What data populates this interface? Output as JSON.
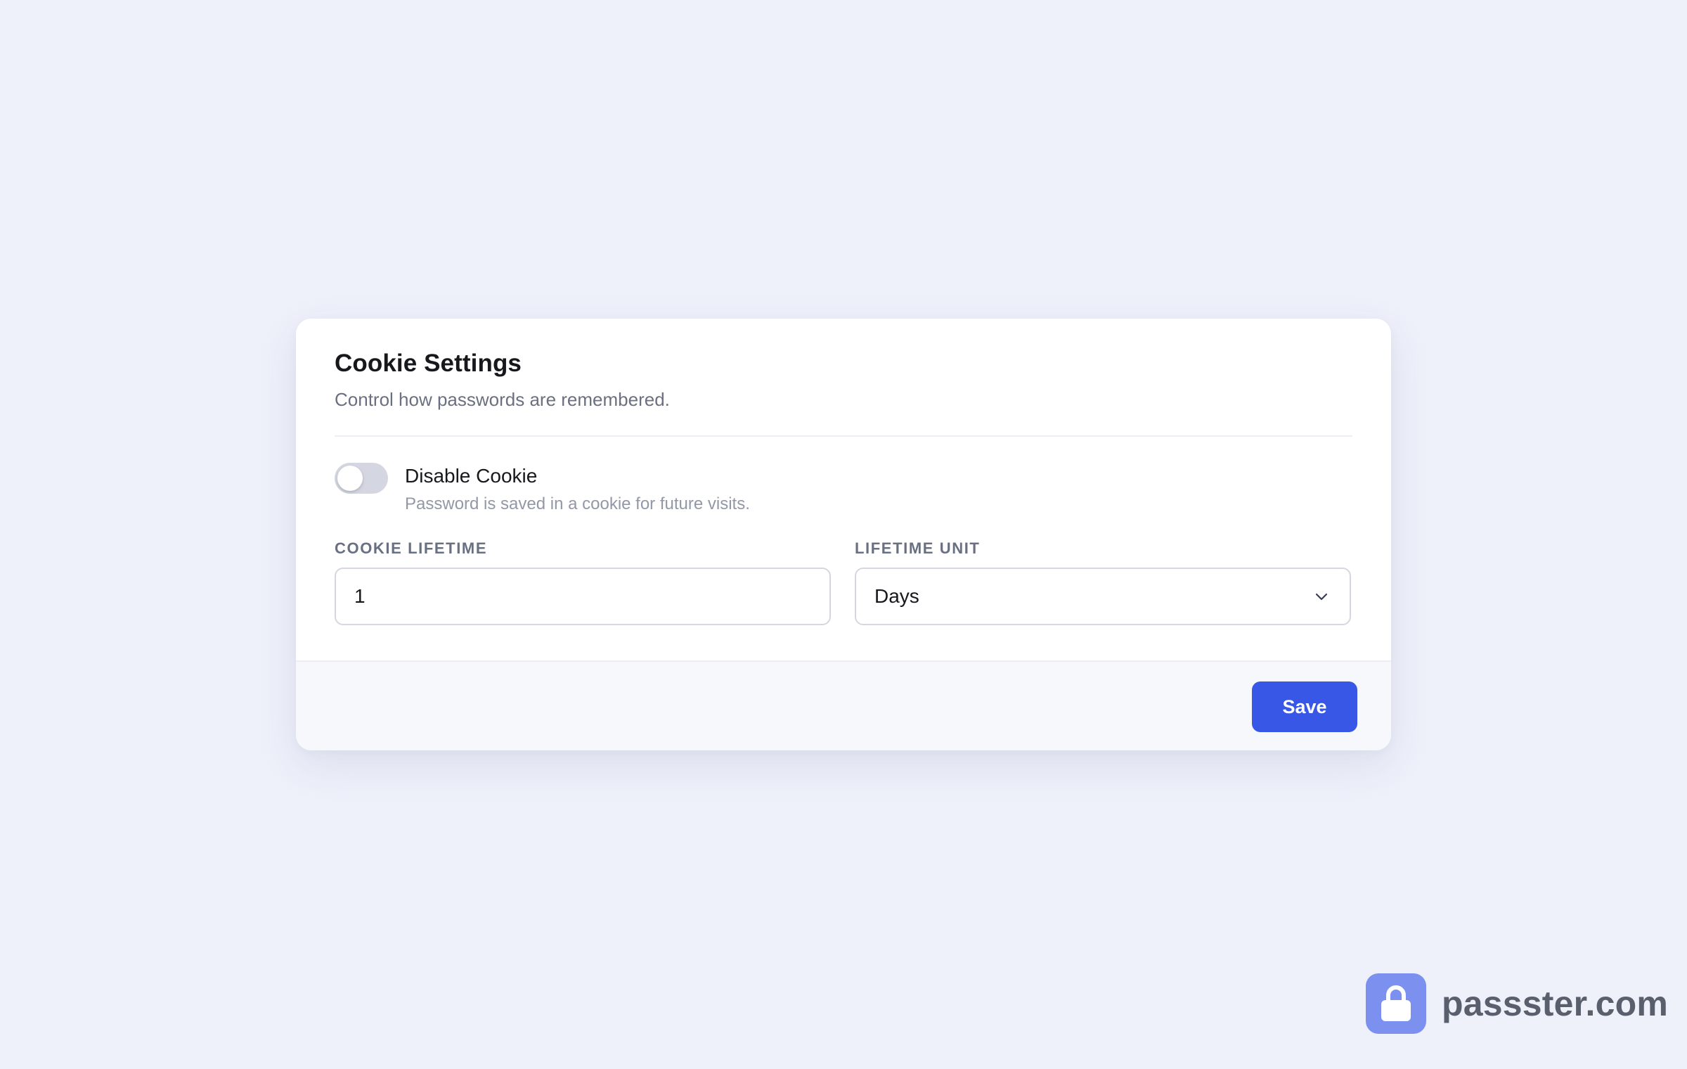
{
  "card": {
    "title": "Cookie Settings",
    "subtitle": "Control how passwords are remembered."
  },
  "toggle": {
    "label": "Disable Cookie",
    "help": "Password is saved in a cookie for future visits.",
    "enabled": false
  },
  "fields": {
    "lifetime_label": "COOKIE LIFETIME",
    "lifetime_value": "1",
    "unit_label": "LIFETIME UNIT",
    "unit_value": "Days"
  },
  "footer": {
    "save_label": "Save"
  },
  "brand": {
    "icon": "lock-icon",
    "text": "passster.com"
  },
  "colors": {
    "background": "#eef0fa",
    "accent": "#3857e6",
    "brand_icon": "#7b90ef"
  }
}
